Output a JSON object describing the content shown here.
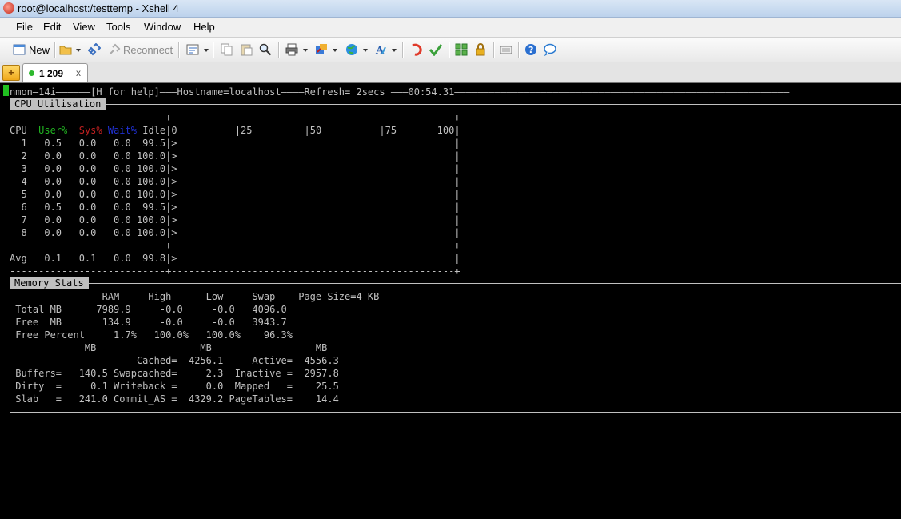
{
  "window": {
    "title": "root@localhost:/testtemp - Xshell 4"
  },
  "menu": [
    "File",
    "Edit",
    "View",
    "Tools",
    "Window",
    "Help"
  ],
  "toolbar": {
    "new_label": "New",
    "reconnect_label": "Reconnect"
  },
  "tab": {
    "label": "1 209",
    "close": "x",
    "add": "+"
  },
  "colors": {
    "user": "#20b020",
    "sys": "#c02020",
    "wait": "#2030d0",
    "cursor": "#20c020",
    "text": "#c0c0c0"
  },
  "terminal": {
    "header": "nmon—14i——————[H for help]———Hostname=localhost————Refresh= 2secs ———00:54.31——————————————————————————————————————————————————————————",
    "cpu": {
      "title": "CPU Utilisation",
      "border": "---------------------------+-------------------------------------------------+",
      "hdr_cpu": "CPU",
      "hdr_user": "User%",
      "hdr_sys": "Sys%",
      "hdr_wait": "Wait%",
      "hdr_rest": "Idle|0          |25         |50          |75       100|",
      "rows": [
        "  1   0.5   0.0   0.0  99.5|>                                                |",
        "  2   0.0   0.0   0.0 100.0|>                                                |",
        "  3   0.0   0.0   0.0 100.0|>                                                |",
        "  4   0.0   0.0   0.0 100.0|>                                                |",
        "  5   0.0   0.0   0.0 100.0|>                                                |",
        "  6   0.5   0.0   0.0  99.5|>                                                |",
        "  7   0.0   0.0   0.0 100.0|>                                                |",
        "  8   0.0   0.0   0.0 100.0|>                                                |"
      ],
      "avg": "Avg   0.1   0.1   0.0  99.8|>                                                |"
    },
    "mem": {
      "title": "Memory Stats",
      "lines": [
        "                RAM     High      Low     Swap    Page Size=4 KB",
        " Total MB      7989.9     -0.0     -0.0   4096.0",
        " Free  MB       134.9     -0.0     -0.0   3943.7",
        " Free Percent     1.7%   100.0%   100.0%    96.3%",
        "             MB                  MB                  MB",
        "                      Cached=  4256.1     Active=  4556.3",
        " Buffers=   140.5 Swapcached=     2.3  Inactive =  2957.8",
        " Dirty  =     0.1 Writeback =     0.0  Mapped   =    25.5",
        " Slab   =   241.0 Commit_AS =  4329.2 PageTables=    14.4"
      ]
    }
  }
}
